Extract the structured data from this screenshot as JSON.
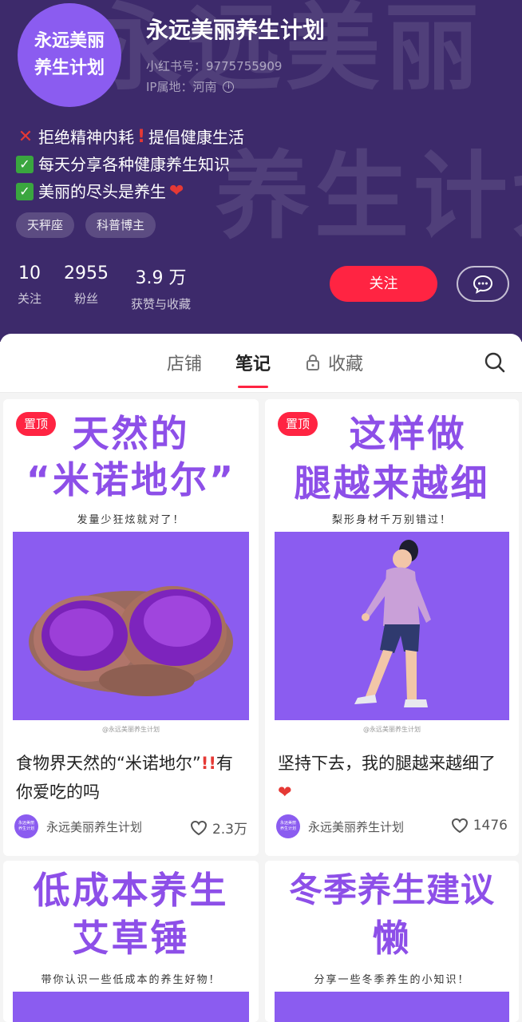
{
  "profile": {
    "avatar_line1": "永远美丽",
    "avatar_line2": "养生计划",
    "nickname": "永远美丽养生计划",
    "id_label": "小红书号：9775755909",
    "ip_label": "IP属地：河南",
    "watermark_line1": "永远美丽",
    "watermark_line2": "养生计划",
    "bio": {
      "line1_a": "拒绝精神内耗",
      "line1_b": "提倡健康生活",
      "line2": "每天分享各种健康养生知识",
      "line3": "美丽的尽头是养生"
    },
    "tags": [
      "天秤座",
      "科普博主"
    ],
    "stats": [
      {
        "value": "10",
        "label": "关注"
      },
      {
        "value": "2955",
        "label": "粉丝"
      },
      {
        "value": "3.9 万",
        "label": "获赞与收藏"
      }
    ],
    "follow_label": "关注",
    "colors": {
      "header_bg": "#3d2a6b",
      "accent": "#ff2442",
      "brand_purple": "#8b5cf0"
    }
  },
  "tabs": {
    "shop": "店铺",
    "notes": "笔记",
    "favorites": "收藏",
    "active": "笔记"
  },
  "notes": [
    {
      "pin": "置顶",
      "cover_line1": "天然的",
      "cover_line2": "“米诺地尔”",
      "cover_sub": "发量少狂炫就对了！",
      "watermark": "@永远美丽养生计划",
      "title_a": "食物界天然的“米诺地尔”",
      "title_b": "有你爱吃的吗",
      "author": "永远美丽养生计划",
      "likes": "2.3万"
    },
    {
      "pin": "置顶",
      "cover_line1": "这样做",
      "cover_line2": "腿越来越细",
      "cover_sub": "梨形身材千万别错过！",
      "watermark": "@永远美丽养生计划",
      "title_a": "坚持下去，我的腿越来越细了",
      "author": "永远美丽养生计划",
      "likes": "1476"
    },
    {
      "cover_line1": "低成本养生",
      "cover_line2": "艾草锤",
      "cover_sub": "带你认识一些低成本的养生好物！"
    },
    {
      "cover_line1": "冬季养生建议",
      "cover_line2": "懒",
      "cover_sub": "分享一些冬季养生的小知识！"
    }
  ],
  "mini_avatar": {
    "line1": "永远美丽",
    "line2": "养生计划"
  },
  "icons": [
    "info-icon",
    "message-icon",
    "lock-icon",
    "search-icon",
    "heart-icon"
  ]
}
